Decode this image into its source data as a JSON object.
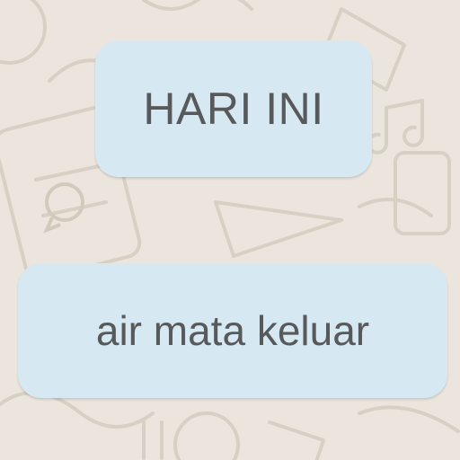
{
  "chat": {
    "date_separator": "HARI INI",
    "message_text": "air mata keluar"
  },
  "colors": {
    "wallpaper": "#ECE5DD",
    "bubble": "#D6E8F1",
    "text": "#58595B"
  },
  "icons": [
    "whatsapp-doodle-wallpaper",
    "whatsapp-logo-icon",
    "music-note-icon",
    "camera-icon"
  ]
}
